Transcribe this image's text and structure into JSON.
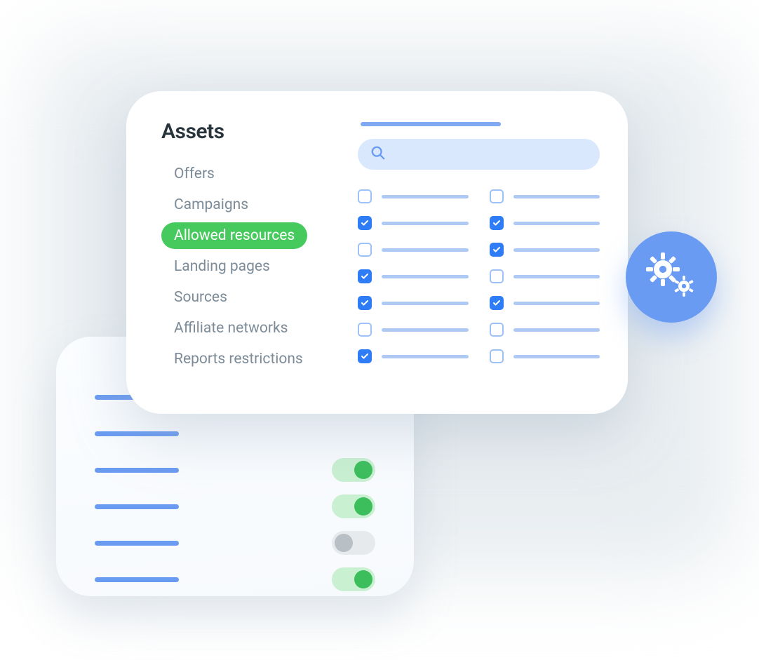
{
  "sidebar": {
    "title": "Assets",
    "items": [
      {
        "label": "Offers",
        "active": false
      },
      {
        "label": "Campaigns",
        "active": false
      },
      {
        "label": "Allowed resources",
        "active": true
      },
      {
        "label": "Landing pages",
        "active": false
      },
      {
        "label": "Sources",
        "active": false
      },
      {
        "label": "Affiliate networks",
        "active": false
      },
      {
        "label": "Reports restrictions",
        "active": false
      }
    ]
  },
  "search": {
    "placeholder": ""
  },
  "checkbox_grid": {
    "left": [
      false,
      true,
      false,
      true,
      true,
      false,
      true
    ],
    "right": [
      false,
      true,
      true,
      false,
      true,
      false,
      false
    ]
  },
  "toggles": [
    true,
    true,
    false,
    true
  ],
  "colors": {
    "accent_blue": "#6A9BF2",
    "accent_green": "#46C95D",
    "checkbox_blue": "#2E7CF6",
    "text_muted": "#7C8B97"
  },
  "icons": {
    "search": "search-icon",
    "gears": "gears-icon",
    "check": "check-icon"
  }
}
